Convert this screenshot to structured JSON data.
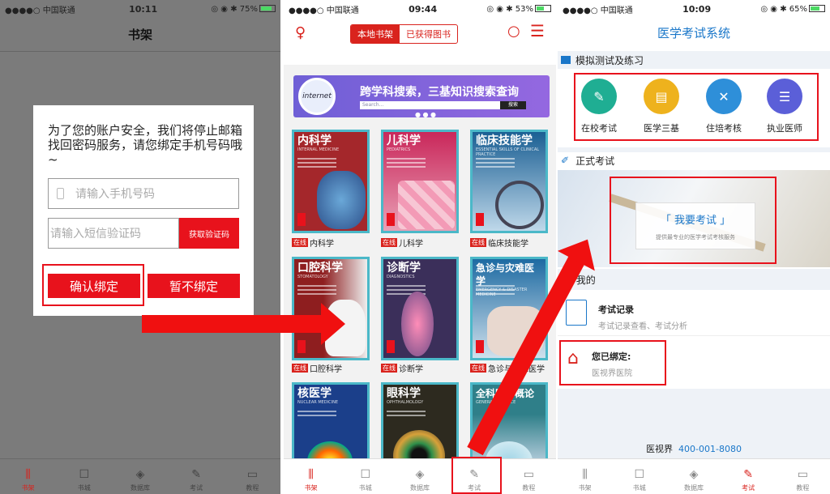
{
  "panel1": {
    "status": {
      "carrier": "●●●●○ 中国联通 ",
      "time": "10:11",
      "right": "75%"
    },
    "nav_title": "书架",
    "dialog": {
      "message": "为了您的账户安全，我们将停止邮箱找回密码服务，请您绑定手机号码哦~",
      "phone_placeholder": "请输入手机号码",
      "sms_placeholder": "请输入短信验证码",
      "get_code": "获取验证码",
      "confirm": "确认绑定",
      "later": "暂不绑定"
    },
    "tabs": [
      "书架",
      "书城",
      "数据库",
      "考试",
      "教程"
    ]
  },
  "panel2": {
    "status": {
      "carrier": "●●●●○ 中国联通 ",
      "time": "09:44",
      "right": "53%"
    },
    "seg": [
      "本地书架",
      "已获得图书"
    ],
    "banner": {
      "circle": "internet",
      "text": "跨学科搜索，三基知识搜索查询",
      "search_hint": "Search...",
      "search_btn": "搜索"
    },
    "badge": "在线",
    "books": [
      {
        "title": "内科学",
        "en": "INTERNAL MEDICINE",
        "caption": "内科学",
        "color": "#a4272b"
      },
      {
        "title": "儿科学",
        "en": "PEDIATRICS",
        "caption": "儿科学",
        "color": "#c9275a"
      },
      {
        "title": "临床技能学",
        "en": "ESSENTIAL SKILLS OF CLINICAL PRACTICE",
        "caption": "临床技能学",
        "color": "#1a5f93"
      },
      {
        "title": "口腔科学",
        "en": "STOMATOLOGY",
        "caption": "口腔科学",
        "color": "#8e1e1f"
      },
      {
        "title": "诊断学",
        "en": "DIAGNOSTICS",
        "caption": "诊断学",
        "color": "#6b4a86"
      },
      {
        "title": "急诊与灾难医学",
        "en": "EMERGENCY & DISASTER MEDICINE",
        "caption": "急诊与灾难医学",
        "color": "#1d6aa2"
      },
      {
        "title": "核医学",
        "en": "NUCLEAR MEDICINE",
        "caption": "",
        "color": "#1b3f8a"
      },
      {
        "title": "眼科学",
        "en": "OPHTHALMOLOGY",
        "caption": "",
        "color": "#2a6b3a"
      },
      {
        "title": "全科医学概论",
        "en": "GENERAL PRACTICE",
        "caption": "",
        "color": "#2f7f89"
      }
    ],
    "tabs": [
      "书架",
      "书城",
      "数据库",
      "考试",
      "教程"
    ]
  },
  "panel3": {
    "status": {
      "carrier": "●●●●○ 中国联通 ",
      "time": "10:09",
      "right": "65%"
    },
    "title": "医学考试系统",
    "sec1": "模拟测试及练习",
    "practice": [
      "在校考试",
      "医学三基",
      "住培考核",
      "执业医师"
    ],
    "sec2": "正式考试",
    "exam_banner": {
      "title": "「 我要考试 」",
      "sub": "提供最专业的医学考试考核服务"
    },
    "sec3": "我的",
    "records": {
      "title": "考试记录",
      "sub": "考试记录查看、考试分析"
    },
    "bound": {
      "title": "您已绑定:",
      "sub": "医视界医院"
    },
    "footer": {
      "brand": "医视界",
      "phone": "400-001-8080"
    },
    "tabs": [
      "书架",
      "书城",
      "数据库",
      "考试",
      "教程"
    ]
  },
  "colors": {
    "accent": "#d9231d",
    "blue": "#1a77c9"
  }
}
